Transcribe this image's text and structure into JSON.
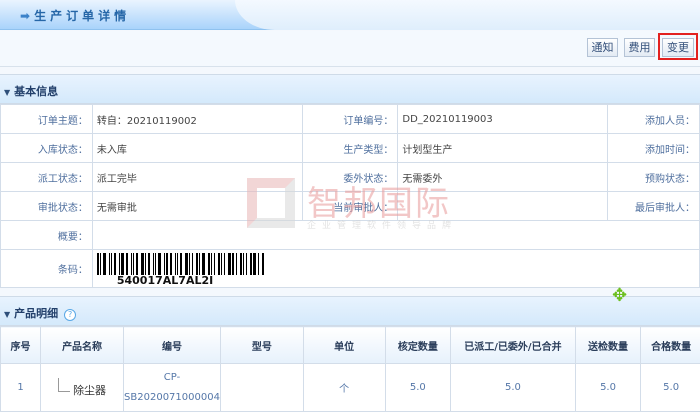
{
  "page_title": "生产订单详情",
  "toolbar": {
    "notify": "通知",
    "cost": "费用",
    "change": "变更"
  },
  "basic": {
    "title": "基本信息",
    "rows": [
      [
        {
          "l": "订单主题：",
          "v": "转自：20210119002"
        },
        {
          "l": "订单编号：",
          "v": "DD_20210119003"
        },
        {
          "l": "添加人员：",
          "v": ""
        }
      ],
      [
        {
          "l": "入库状态：",
          "v": "未入库"
        },
        {
          "l": "生产类型：",
          "v": "计划型生产"
        },
        {
          "l": "添加时间：",
          "v": ""
        }
      ],
      [
        {
          "l": "派工状态：",
          "v": "派工完毕"
        },
        {
          "l": "委外状态：",
          "v": "无需委外"
        },
        {
          "l": "预购状态：",
          "v": ""
        }
      ],
      [
        {
          "l": "审批状态：",
          "v": "无需审批"
        },
        {
          "l": "当前审批人：",
          "v": ""
        },
        {
          "l": "最后审批人：",
          "v": ""
        }
      ]
    ],
    "summary_label": "概要：",
    "summary": "",
    "barcode_label": "条码：",
    "barcode": "540017AL7AL2I"
  },
  "products": {
    "title": "产品明细",
    "headers": [
      "序号",
      "产品名称",
      "编号",
      "型号",
      "单位",
      "核定数量",
      "已派工/已委外/已合并",
      "送检数量",
      "合格数量"
    ],
    "rows": [
      [
        "1",
        "除尘器",
        "CP-SB2020071000004",
        "",
        "个",
        "5.0",
        "5.0",
        "5.0",
        "5.0"
      ]
    ]
  },
  "watermark": {
    "name": "智邦国际",
    "slogan": "企业管理软件领导品牌"
  }
}
